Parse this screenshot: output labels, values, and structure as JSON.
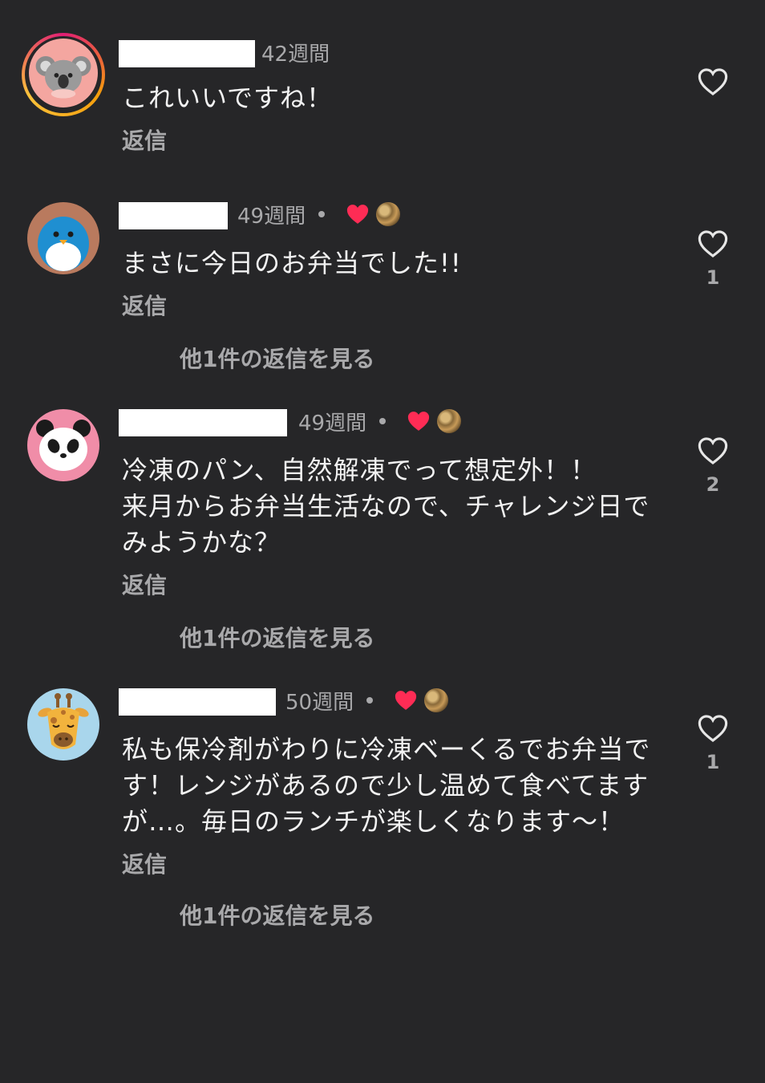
{
  "comments": [
    {
      "avatar_icon": "koala-avatar-icon",
      "time": "42週間",
      "text": "これいいですね！",
      "reply_label": "返信",
      "liked_by_creator": false,
      "like_count": null,
      "more_replies": null
    },
    {
      "avatar_icon": "penguin-avatar-icon",
      "time": "49週間",
      "text": "まさに今日のお弁当でした!!",
      "reply_label": "返信",
      "liked_by_creator": true,
      "like_count": "1",
      "more_replies": "他1件の返信を見る"
    },
    {
      "avatar_icon": "panda-avatar-icon",
      "time": "49週間",
      "text": "冷凍のパン、自然解凍でって想定外！！\n来月からお弁当生活なので、チャレンジ日で\nみようかな？",
      "reply_label": "返信",
      "liked_by_creator": true,
      "like_count": "2",
      "more_replies": "他1件の返信を見る"
    },
    {
      "avatar_icon": "giraffe-avatar-icon",
      "time": "50週間",
      "text": "私も保冷剤がわりに冷凍ベーくるでお弁当で\nす！レンジがあるので少し温めて食べてます\nが…。毎日のランチが楽しくなります〜！",
      "reply_label": "返信",
      "liked_by_creator": true,
      "like_count": "1",
      "more_replies": "他1件の返信を見る"
    }
  ],
  "colors": {
    "background": "#262628",
    "text_primary": "#f2f2f2",
    "text_secondary": "#a9a9ab",
    "creator_heart": "#fe2c55"
  }
}
